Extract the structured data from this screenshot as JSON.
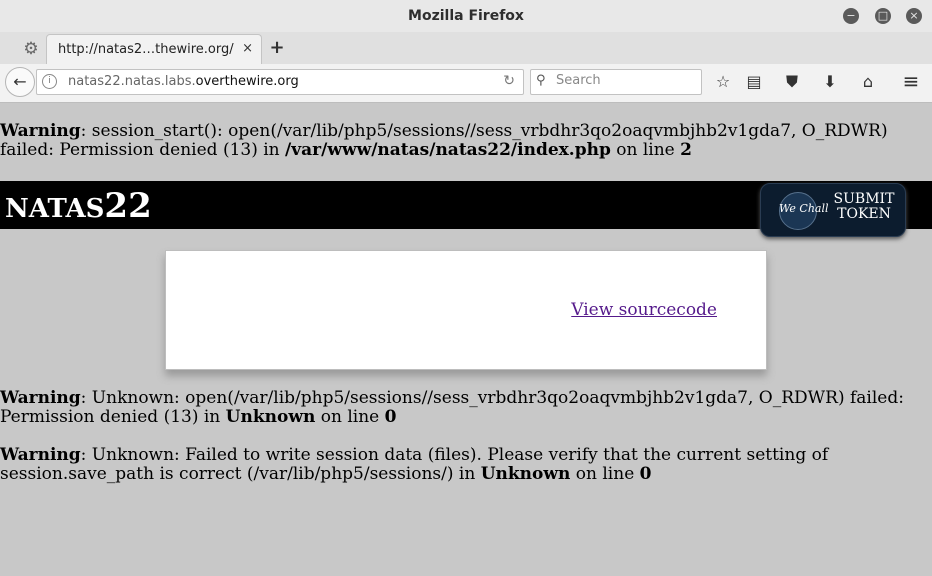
{
  "window": {
    "title": "Mozilla Firefox",
    "buttons": {
      "minimize": "−",
      "maximize": "□",
      "close": "×"
    }
  },
  "tabs": [
    {
      "title": "http://natas2…thewire.org/",
      "close": "×"
    }
  ],
  "tabbar": {
    "settings_icon": "⚙",
    "new_tab": "+"
  },
  "navbar": {
    "back_icon": "←",
    "info_icon": "i",
    "url_prefix": "natas22.natas.labs.",
    "url_domain": "overthewire.org",
    "reload_icon": "↻",
    "search_placeholder": "Search",
    "search_icon": "⚲",
    "toolbar": {
      "bookmark_icon": "☆",
      "reading_list_icon": "▤",
      "pocket_icon": "⛊",
      "downloads_icon": "⬇",
      "home_icon": "⌂",
      "menu_icon": "≡"
    }
  },
  "page": {
    "warnings": [
      {
        "label": "Warning",
        "message": ": session_start(): open(/var/lib/php5/sessions//sess_vrbdhr3qo2oaqvmbjhb2v1gda7, O_RDWR) failed: Permission denied (13) in ",
        "file": "/var/www/natas/natas22/index.php",
        "online": " on line ",
        "line": "2"
      },
      {
        "label": "Warning",
        "message": ": Unknown: open(/var/lib/php5/sessions//sess_vrbdhr3qo2oaqvmbjhb2v1gda7, O_RDWR) failed: Permission denied (13) in ",
        "file": "Unknown",
        "online": " on line ",
        "line": "0"
      },
      {
        "label": "Warning",
        "message": ": Unknown: Failed to write session data (files). Please verify that the current setting of session.save_path is correct (/var/lib/php5/sessions/) in ",
        "file": "Unknown",
        "online": " on line ",
        "line": "0"
      }
    ],
    "header": {
      "logo_prefix": "NATAS",
      "logo_number": "22"
    },
    "token": {
      "brand": "We Chall",
      "line1": "SUBMIT",
      "line2": "TOKEN"
    },
    "content": {
      "link": "View sourcecode"
    }
  }
}
